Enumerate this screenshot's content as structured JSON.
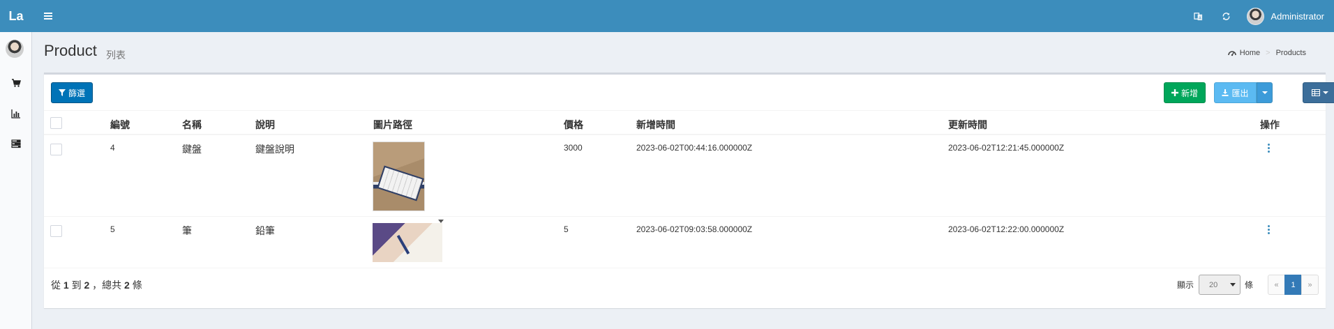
{
  "header": {
    "logo": "La",
    "user_name": "Administrator",
    "icons": [
      "menu-toggle-icon",
      "language-icon",
      "refresh-icon"
    ]
  },
  "sidebar": {
    "items": [
      {
        "icon": "shopping-cart-icon"
      },
      {
        "icon": "bar-chart-icon"
      },
      {
        "icon": "tasks-icon"
      }
    ]
  },
  "page": {
    "title": "Product",
    "subtitle": "列表"
  },
  "breadcrumb": {
    "home": "Home",
    "current": "Products"
  },
  "toolbar": {
    "filter_label": "篩選",
    "new_label": "新增",
    "export_label": "匯出"
  },
  "table": {
    "columns": [
      "編號",
      "名稱",
      "說明",
      "圖片路徑",
      "價格",
      "新增時間",
      "更新時間",
      "操作"
    ],
    "rows": [
      {
        "id": "4",
        "name": "鍵盤",
        "description": "鍵盤說明",
        "image": "keyboard-photo",
        "price": "3000",
        "created_at": "2023-06-02T00:44:16.000000Z",
        "updated_at": "2023-06-02T12:21:45.000000Z"
      },
      {
        "id": "5",
        "name": "筆",
        "description": "鉛筆",
        "image": "pencil-writing-photo",
        "price": "5",
        "created_at": "2023-06-02T09:03:58.000000Z",
        "updated_at": "2023-06-02T12:22:00.000000Z"
      }
    ]
  },
  "footer": {
    "from_label": "從",
    "from": "1",
    "to_label": "到",
    "to": "2",
    "total_label": "，總共",
    "total": "2",
    "unit": "條",
    "show_label": "顯示",
    "per_page": "20",
    "per_page_unit": "條",
    "pagination": {
      "prev": "«",
      "current": "1",
      "next": "»"
    }
  },
  "colors": {
    "header_bg": "#3c8dbc",
    "filter_button": "#0073b7",
    "new_button": "#00a65a",
    "export_button": "#5bbaf2",
    "columns_button": "#3c6e9a",
    "active_page": "#337ab7"
  }
}
